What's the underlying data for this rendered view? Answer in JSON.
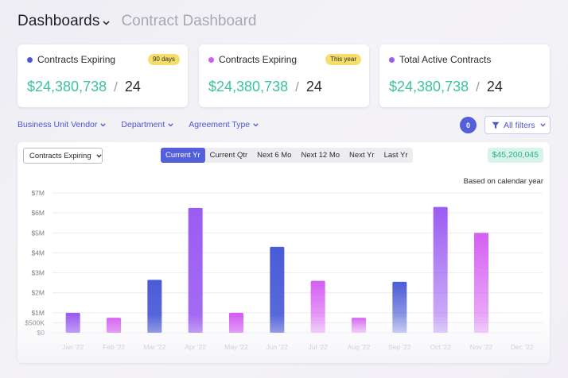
{
  "header": {
    "title": "Dashboards",
    "subtitle": "Contract Dashboard"
  },
  "cards": [
    {
      "label": "Contracts Expiring",
      "badge": "90 days",
      "amount": "$24,380,738",
      "count": "24",
      "dot_color": "#4a57d6"
    },
    {
      "label": "Contracts Expiring",
      "badge": "This year",
      "amount": "$24,380,738",
      "count": "24",
      "dot_color": "#d15ef0"
    },
    {
      "label": "Total Active Contracts",
      "badge": "",
      "amount": "$24,380,738",
      "count": "24",
      "dot_color": "#9c5cf0"
    }
  ],
  "separator": "/",
  "filters": {
    "items": [
      "Business Unit Vendor",
      "Department",
      "Agreement Type"
    ],
    "count": "0",
    "all_label": "All filters"
  },
  "panel": {
    "select_value": "Contracts Expiring",
    "tabs": [
      "Current Yr",
      "Current Qtr",
      "Next 6 Mo",
      "Next 12 Mo",
      "Next Yr",
      "Last Yr"
    ],
    "active_tab": 0,
    "total": "$45,200,045",
    "note": "Based on calendar year"
  },
  "chart_data": {
    "type": "bar",
    "title": "",
    "xlabel": "",
    "ylabel": "",
    "categories": [
      "Jan '22",
      "Feb '22",
      "Mar '22",
      "Apr '22",
      "May '22",
      "Jun '22",
      "Jul '22",
      "Aug '22",
      "Sep '22",
      "Oct '22",
      "Nov '22",
      "Dec '22"
    ],
    "values": [
      1000000,
      750000,
      2650000,
      6250000,
      1000000,
      4300000,
      2600000,
      750000,
      2550000,
      6300000,
      5000000,
      0
    ],
    "bar_colors": [
      "#9b5cf2",
      "#d55ef3",
      "#4a5bd8",
      "#9b5cf2",
      "#d55ef3",
      "#4a5bd8",
      "#d55ef3",
      "#d55ef3",
      "#4a5bd8",
      "#9b5cf2",
      "#d55ef3",
      "#d55ef3"
    ],
    "yticks": [
      {
        "value": 0,
        "label": "$0"
      },
      {
        "value": 500000,
        "label": "$500K"
      },
      {
        "value": 1000000,
        "label": "$1M"
      },
      {
        "value": 2000000,
        "label": "$2M"
      },
      {
        "value": 3000000,
        "label": "$3M"
      },
      {
        "value": 4000000,
        "label": "$4M"
      },
      {
        "value": 5000000,
        "label": "$5M"
      },
      {
        "value": 6000000,
        "label": "$6M"
      },
      {
        "value": 7000000,
        "label": "$7M"
      }
    ],
    "ylim": [
      0,
      7000000
    ],
    "grid": true
  }
}
